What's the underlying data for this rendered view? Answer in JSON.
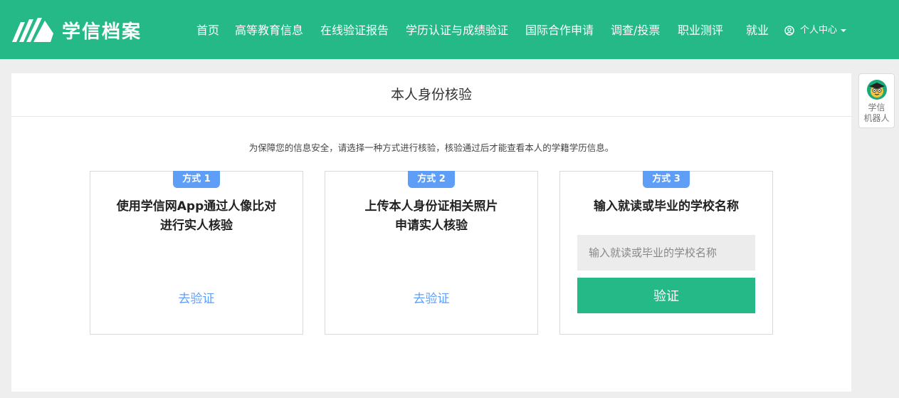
{
  "brand": {
    "name": "学信档案"
  },
  "nav": {
    "items": [
      {
        "label": "首页"
      },
      {
        "label": "高等教育信息"
      },
      {
        "label": "在线验证报告"
      },
      {
        "label": "学历认证与成绩验证"
      },
      {
        "label": "国际合作申请"
      },
      {
        "label": "调查/投票"
      },
      {
        "label": "职业测评"
      },
      {
        "label": "就业"
      }
    ],
    "user_menu": "个人中心"
  },
  "page": {
    "title": "本人身份核验",
    "notice": "为保障您的信息安全，请选择一种方式进行核验，核验通过后才能查看本人的学籍学历信息。"
  },
  "methods": [
    {
      "badge": "方式 1",
      "title_line1": "使用学信网App通过人像比对",
      "title_line2": "进行实人核验",
      "link": "去验证"
    },
    {
      "badge": "方式 2",
      "title_line1": "上传本人身份证相关照片",
      "title_line2": "申请实人核验",
      "link": "去验证"
    },
    {
      "badge": "方式 3",
      "title_line1": "输入就读或毕业的学校名称",
      "input_placeholder": "输入就读或毕业的学校名称",
      "button": "验证"
    }
  ],
  "robot": {
    "line1": "学信",
    "line2": "机器人"
  },
  "colors": {
    "brand_green": "#25b988",
    "badge_blue": "#5e9ef7",
    "background": "#eeeeee"
  },
  "icons": [
    "brand-logo-icon",
    "user-circle-icon",
    "caret-down-icon",
    "robot-avatar-icon"
  ]
}
